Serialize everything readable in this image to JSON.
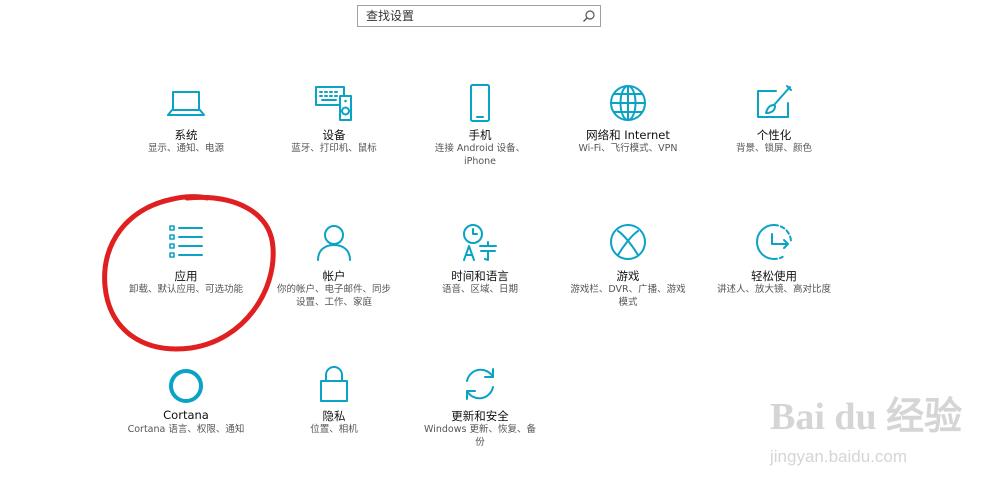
{
  "search": {
    "placeholder": "查找设置"
  },
  "tiles": [
    {
      "name": "系统",
      "desc": "显示、通知、电源",
      "icon": "laptop-icon"
    },
    {
      "name": "设备",
      "desc": "蓝牙、打印机、鼠标",
      "icon": "devices-icon"
    },
    {
      "name": "手机",
      "desc": "连接 Android 设备、\niPhone",
      "icon": "phone-icon"
    },
    {
      "name": "网络和 Internet",
      "desc": "Wi-Fi、飞行模式、VPN",
      "icon": "globe-icon"
    },
    {
      "name": "个性化",
      "desc": "背景、锁屏、颜色",
      "icon": "personalization-icon"
    },
    {
      "name": "应用",
      "desc": "卸载、默认应用、可选功能",
      "icon": "apps-list-icon"
    },
    {
      "name": "帐户",
      "desc": "你的帐户、电子邮件、同步\n设置、工作、家庭",
      "icon": "person-icon"
    },
    {
      "name": "时间和语言",
      "desc": "语音、区域、日期",
      "icon": "time-language-icon"
    },
    {
      "name": "游戏",
      "desc": "游戏栏、DVR、广播、游戏\n模式",
      "icon": "xbox-icon"
    },
    {
      "name": "轻松使用",
      "desc": "讲述人、放大镜、高对比度",
      "icon": "ease-of-access-icon"
    },
    {
      "name": "Cortana",
      "desc": "Cortana 语言、权限、通知",
      "icon": "cortana-icon"
    },
    {
      "name": "隐私",
      "desc": "位置、相机",
      "icon": "lock-icon"
    },
    {
      "name": "更新和安全",
      "desc": "Windows 更新、恢复、备\n份",
      "icon": "update-icon"
    }
  ],
  "watermark": {
    "brand": "Bai du 经验",
    "url": "jingyan.baidu.com"
  },
  "colors": {
    "accent": "#0aa3c6",
    "annotation": "#e02020"
  }
}
